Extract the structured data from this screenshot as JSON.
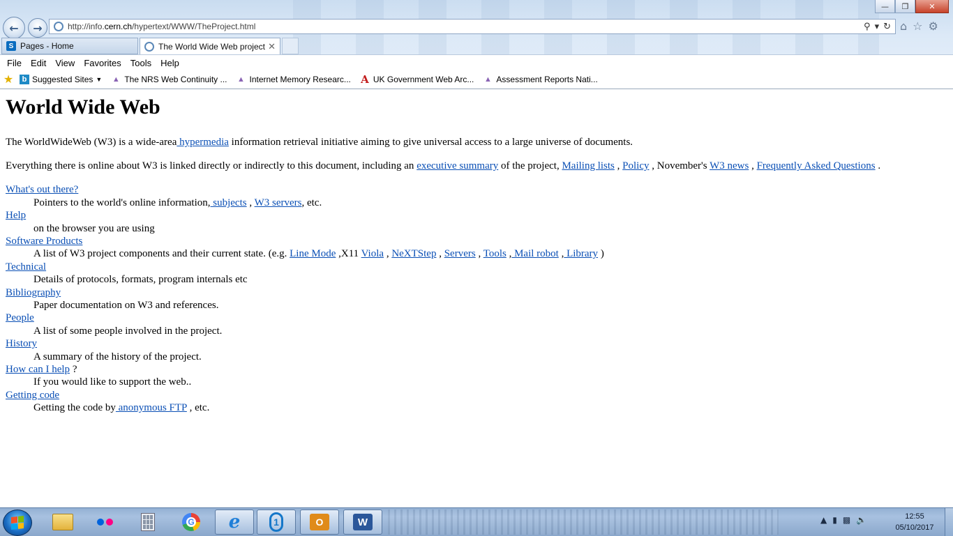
{
  "browser": {
    "url_prefix": "http://info.",
    "url_domain": "cern.ch",
    "url_path": "/hypertext/WWW/TheProject.html",
    "tabs": [
      {
        "label": "Pages - Home"
      },
      {
        "label": "The World Wide Web project"
      }
    ],
    "menu": [
      "File",
      "Edit",
      "View",
      "Favorites",
      "Tools",
      "Help"
    ],
    "favorites": [
      {
        "label": "Suggested Sites"
      },
      {
        "label": "The NRS Web Continuity ..."
      },
      {
        "label": "Internet Memory Researc..."
      },
      {
        "label": "UK Government Web Arc..."
      },
      {
        "label": "Assessment Reports  Nati..."
      }
    ]
  },
  "page": {
    "title": "World Wide Web",
    "intro": {
      "before": "The WorldWideWeb (W3) is a wide-area",
      "link": " hypermedia",
      "after": " information retrieval initiative aiming to give universal access to a large universe of documents."
    },
    "everything": {
      "t1": "Everything there is online about W3 is linked directly or indirectly to this document, including an ",
      "l1": "executive summary",
      "t2": " of the project, ",
      "l2": "Mailing lists",
      "t3": " , ",
      "l3": "Policy",
      "t4": " , November's ",
      "l4": "W3 news",
      "t5": " , ",
      "l5": "Frequently Asked Questions",
      "t6": " ."
    },
    "entries": {
      "whats_out": {
        "term": "What's out there?",
        "t1": "Pointers to the world's online information,",
        "l1": " subjects",
        "t2": " , ",
        "l2": "W3 servers",
        "t3": ", etc."
      },
      "help": {
        "term": "Help",
        "desc": "on the browser you are using"
      },
      "software": {
        "term": "Software Products",
        "t1": "A list of W3 project components and their current state. (e.g. ",
        "l1": "Line Mode",
        "t2": " ,X11 ",
        "l2": "Viola",
        "t3": " , ",
        "l3": "NeXTStep",
        "t4": " , ",
        "l4": "Servers",
        "t5": " , ",
        "l5": "Tools",
        "t6": " ,",
        "l6": " Mail robot",
        "t7": " ,",
        "l7": " Library",
        "t8": " )"
      },
      "technical": {
        "term": "Technical",
        "desc": "Details of protocols, formats, program internals etc"
      },
      "bibliography": {
        "term": "Bibliography",
        "desc": "Paper documentation on W3 and references."
      },
      "people": {
        "term": "People",
        "desc": "A list of some people involved in the project."
      },
      "history": {
        "term": "History",
        "desc": "A summary of the history of the project."
      },
      "howcanihelp": {
        "term": "How can I help",
        "suffix": " ?",
        "desc": "If you would like to support the web.."
      },
      "gettingcode": {
        "term": "Getting code",
        "t1": "Getting the code by",
        "l1": " anonymous FTP",
        "t2": " , etc."
      }
    }
  },
  "taskbar": {
    "apps": [
      "file-explorer",
      "flickr",
      "calculator",
      "google-chrome",
      "internet-explorer",
      "onedrive",
      "outlook",
      "word"
    ],
    "clock_time": "12:55",
    "clock_date": "05/10/2017"
  },
  "colors": {
    "link": "#0a4fb5",
    "chrome_bg": "#dce9f7",
    "taskbar_bg": "#a8c1e0"
  }
}
